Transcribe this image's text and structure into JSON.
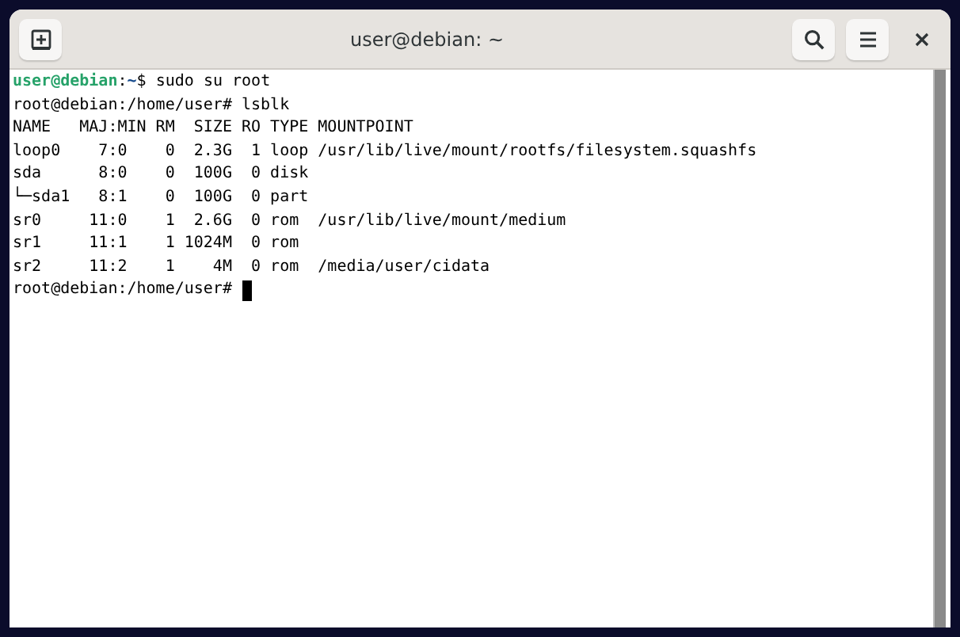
{
  "window": {
    "title": "user@debian: ~"
  },
  "terminal": {
    "lines": [
      {
        "kind": "user_prompt",
        "user_host": "user@debian",
        "separator": ":",
        "path": "~",
        "symbol": "$",
        "command": " sudo su root"
      },
      {
        "kind": "output",
        "text": "root@debian:/home/user# lsblk"
      },
      {
        "kind": "output",
        "text": "NAME   MAJ:MIN RM  SIZE RO TYPE MOUNTPOINT"
      },
      {
        "kind": "output",
        "text": "loop0    7:0    0  2.3G  1 loop /usr/lib/live/mount/rootfs/filesystem.squashfs"
      },
      {
        "kind": "output",
        "text": "sda      8:0    0  100G  0 disk"
      },
      {
        "kind": "output",
        "text": "└─sda1   8:1    0  100G  0 part"
      },
      {
        "kind": "output",
        "text": "sr0     11:0    1  2.6G  0 rom  /usr/lib/live/mount/medium"
      },
      {
        "kind": "output",
        "text": "sr1     11:1    1 1024M  0 rom"
      },
      {
        "kind": "output",
        "text": "sr2     11:2    1    4M  0 rom  /media/user/cidata"
      },
      {
        "kind": "output",
        "text": "root@debian:/home/user# ",
        "cursor": true
      }
    ]
  }
}
